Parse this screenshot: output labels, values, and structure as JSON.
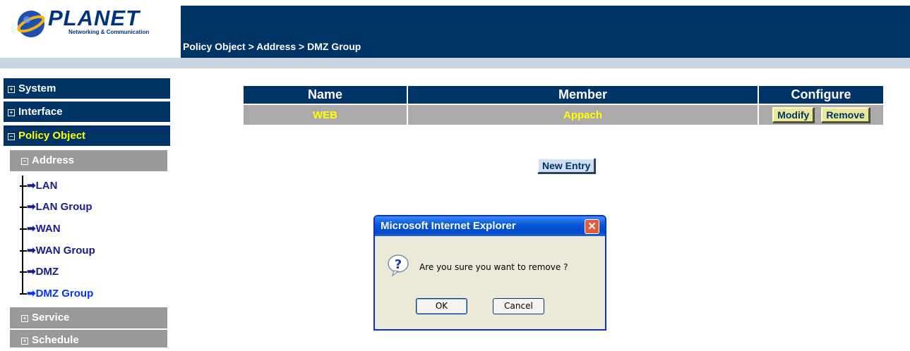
{
  "brand": {
    "name": "PLANET",
    "tagline": "Networking & Communication"
  },
  "breadcrumb": "Policy Object > Address > DMZ Group",
  "sidebar": {
    "top_items": [
      {
        "label": "System",
        "expander": "+"
      },
      {
        "label": "Interface",
        "expander": "+"
      },
      {
        "label": "Policy Object",
        "expander": "−"
      }
    ],
    "address": {
      "label": "Address",
      "expander": "−"
    },
    "address_children": [
      "LAN",
      "LAN Group",
      "WAN",
      "WAN Group",
      "DMZ",
      "DMZ Group"
    ],
    "active_child": "DMZ Group",
    "sub_items": [
      {
        "label": "Service",
        "expander": "+"
      },
      {
        "label": "Schedule",
        "expander": "+"
      }
    ]
  },
  "table": {
    "headers": {
      "name": "Name",
      "member": "Member",
      "configure": "Configure"
    },
    "rows": [
      {
        "name": "WEB",
        "member": "Appach",
        "modify_label": "Modify",
        "remove_label": "Remove"
      }
    ]
  },
  "new_entry_label": "New Entry",
  "dialog": {
    "title": "Microsoft Internet Explorer",
    "message": "Are you sure you want to remove ?",
    "ok_label": "OK",
    "cancel_label": "Cancel"
  },
  "colors": {
    "nav": "#003366",
    "submenu": "#999999",
    "row": "#aaaaaa",
    "row_text": "#ffff00",
    "policy_object": "#ffff00"
  }
}
